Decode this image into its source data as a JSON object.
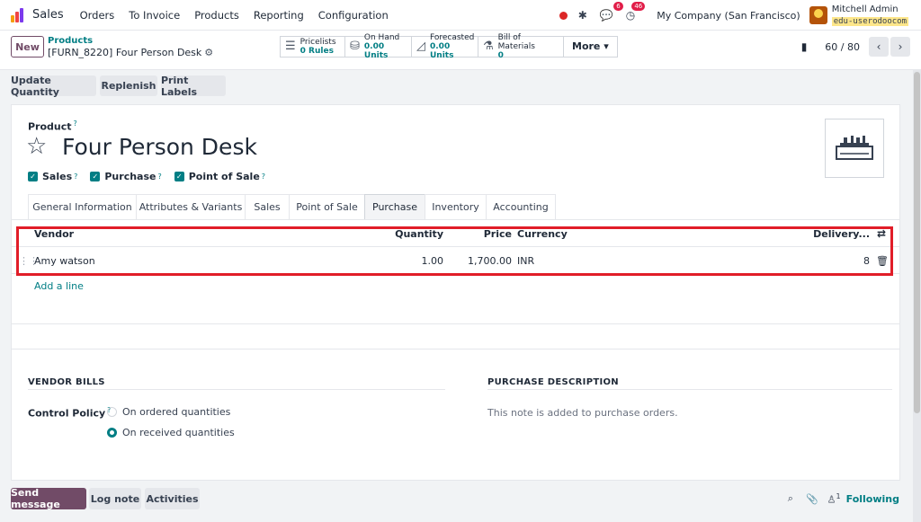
{
  "navbar": {
    "app_name": "Sales",
    "menu": [
      "Orders",
      "To Invoice",
      "Products",
      "Reporting",
      "Configuration"
    ],
    "messages_count": "6",
    "activities_count": "46",
    "company": "My Company (San Francisco)",
    "user_name": "Mitchell Admin",
    "database": "edu-userodoocom"
  },
  "control": {
    "new_label": "New",
    "breadcrumb_parent": "Products",
    "breadcrumb_current": "[FURN_8220] Four Person Desk",
    "smart_buttons": [
      {
        "label": "Pricelists",
        "value": "0 Rules",
        "icon": "list-icon"
      },
      {
        "label": "On Hand",
        "value": "0.00 Units",
        "icon": "cubes-icon"
      },
      {
        "label": "Forecasted",
        "value": "0.00 Units",
        "icon": "area-chart-icon"
      },
      {
        "label": "Bill of Materials",
        "value": "0",
        "icon": "flask-icon"
      }
    ],
    "more_label": "More ▾",
    "pager": "60 / 80"
  },
  "actions": [
    "Update Quantity",
    "Replenish",
    "Print Labels"
  ],
  "product": {
    "label": "Product",
    "help": "?",
    "name": "Four Person Desk",
    "checks": [
      {
        "label": "Sales",
        "help": "?"
      },
      {
        "label": "Purchase",
        "help": "?"
      },
      {
        "label": "Point of Sale",
        "help": "?"
      }
    ]
  },
  "tabs": [
    "General Information",
    "Attributes & Variants",
    "Sales",
    "Point of Sale",
    "Purchase",
    "Inventory",
    "Accounting"
  ],
  "vendor_table": {
    "headers": {
      "vendor": "Vendor",
      "quantity": "Quantity",
      "price": "Price",
      "currency": "Currency",
      "delivery": "Delivery..."
    },
    "rows": [
      {
        "vendor": "Amy watson",
        "quantity": "1.00",
        "price": "1,700.00",
        "currency": "INR",
        "delivery": "8"
      }
    ],
    "add_line": "Add a line"
  },
  "vendor_bills": {
    "title": "VENDOR BILLS",
    "control_policy_label": "Control Policy",
    "help": "?",
    "options": [
      "On ordered quantities",
      "On received quantities"
    ],
    "selected": 1
  },
  "purchase_description": {
    "title": "PURCHASE DESCRIPTION",
    "placeholder": "This note is added to purchase orders."
  },
  "chatter": {
    "send_message": "Send message",
    "log_note": "Log note",
    "activities": "Activities",
    "followers_count": "1",
    "following": "Following"
  }
}
